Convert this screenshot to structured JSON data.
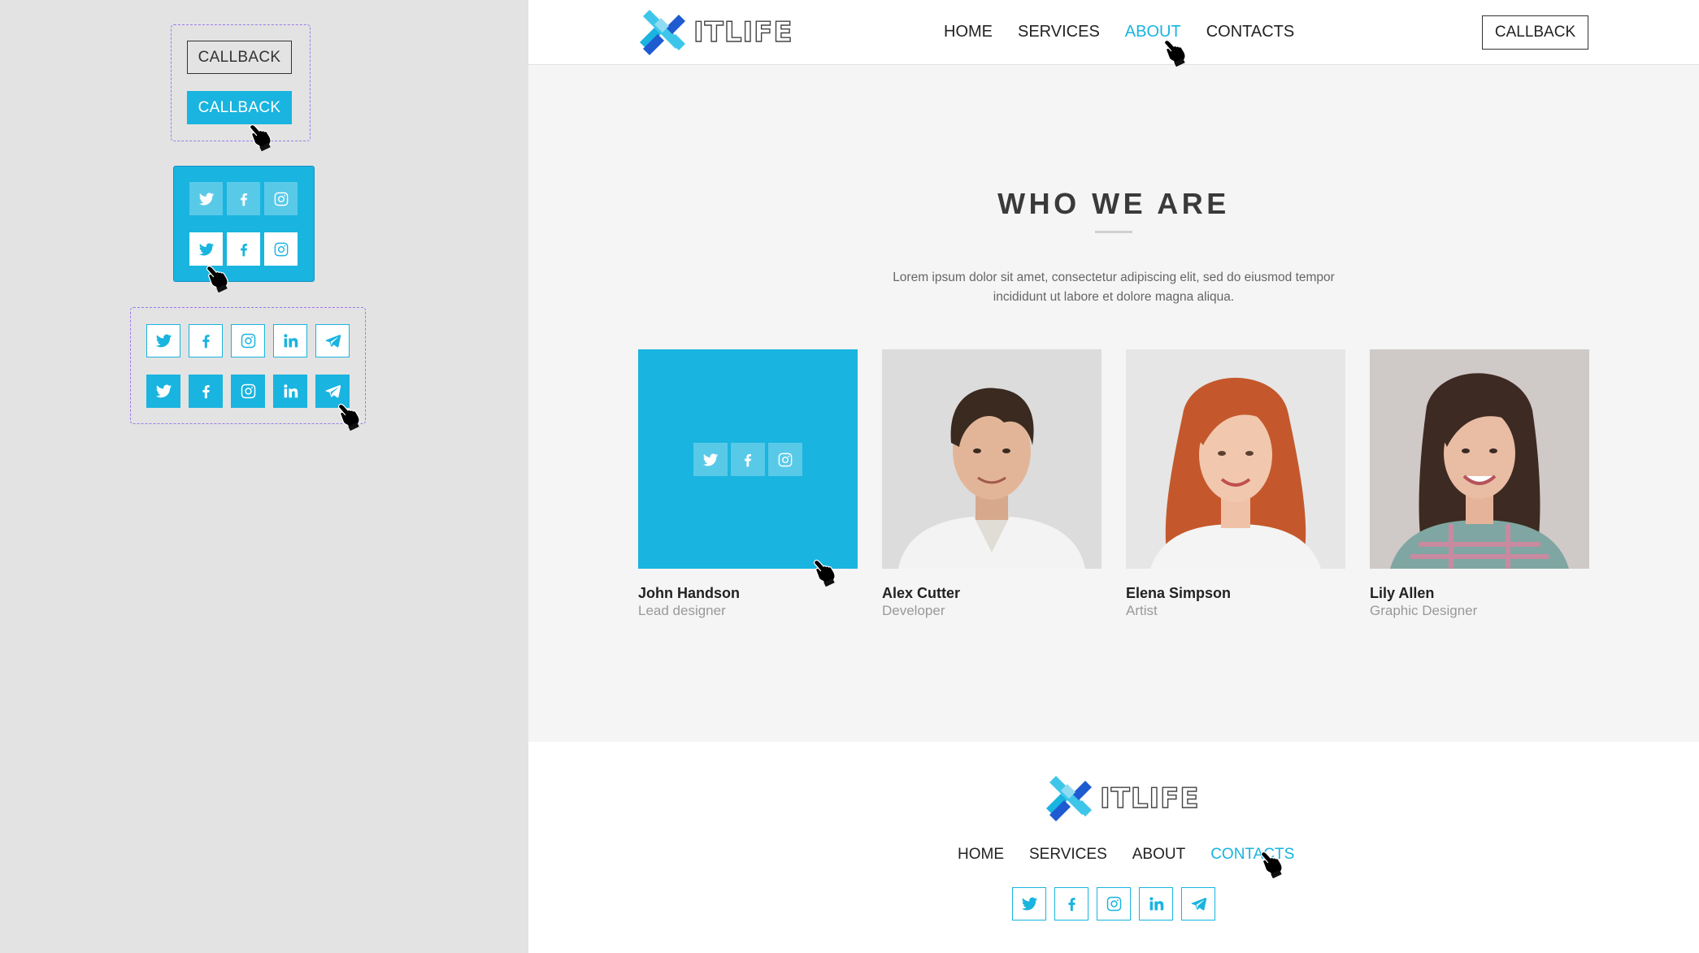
{
  "styleguide": {
    "callback_outline_label": "CALLBACK",
    "callback_filled_label": "CALLBACK",
    "social_small": [
      "twitter-icon",
      "facebook-icon",
      "instagram-icon"
    ],
    "social_large": [
      "twitter-icon",
      "facebook-icon",
      "instagram-icon",
      "linkedin-icon",
      "telegram-icon"
    ]
  },
  "header": {
    "logo_text": "ITLIFE",
    "nav": [
      {
        "label": "HOME",
        "active": false
      },
      {
        "label": "SERVICES",
        "active": false
      },
      {
        "label": "ABOUT",
        "active": true
      },
      {
        "label": "CONTACTS",
        "active": false
      }
    ],
    "callback_label": "CALLBACK"
  },
  "about": {
    "title": "WHO WE ARE",
    "description_line1": "Lorem ipsum dolor sit amet, consectetur adipiscing elit, sed do eiusmod tempor",
    "description_line2": "incididunt ut labore et dolore magna aliqua."
  },
  "team": [
    {
      "name": "John Handson",
      "role": "Lead designer",
      "hovered": true
    },
    {
      "name": "Alex Cutter",
      "role": "Developer",
      "hovered": false
    },
    {
      "name": "Elena Simpson",
      "role": "Artist",
      "hovered": false
    },
    {
      "name": "Lily Allen",
      "role": "Graphic Designer",
      "hovered": false
    }
  ],
  "footer": {
    "logo_text": "ITLIFE",
    "nav": [
      {
        "label": "HOME",
        "active": false
      },
      {
        "label": "SERVICES",
        "active": false
      },
      {
        "label": "ABOUT",
        "active": false
      },
      {
        "label": "CONTACTS",
        "active": true
      }
    ],
    "social": [
      "twitter-icon",
      "facebook-icon",
      "instagram-icon",
      "linkedin-icon",
      "telegram-icon"
    ]
  },
  "colors": {
    "accent": "#19b4df",
    "logo_dark": "#1e5bd1",
    "logo_light": "#3ec6ea",
    "background": "#f5f5f5",
    "panel": "#e3e3e3",
    "guide_border": "#9b7bea"
  }
}
